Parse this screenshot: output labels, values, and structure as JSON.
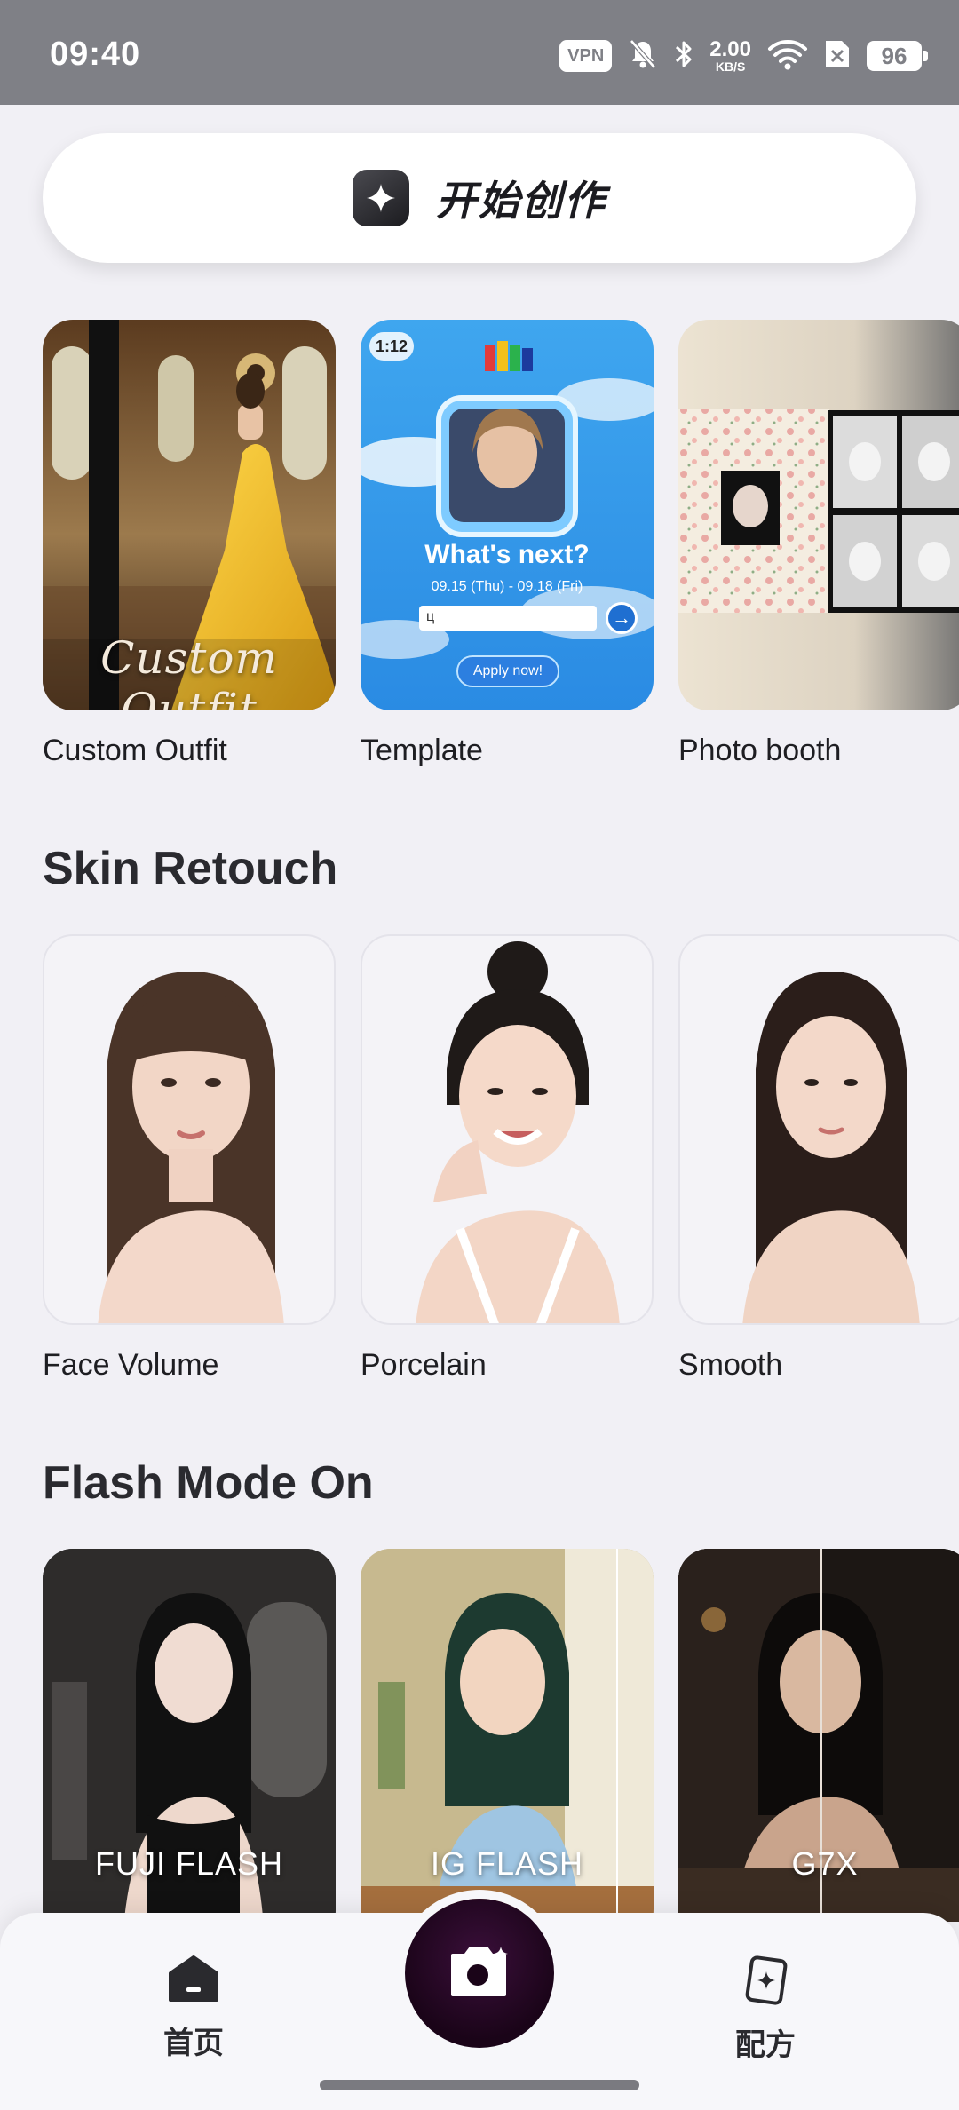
{
  "status_bar": {
    "time": "09:40",
    "vpn": "VPN",
    "speed_value": "2.00",
    "speed_unit": "KB/S",
    "battery": "96"
  },
  "create": {
    "label": "开始创作"
  },
  "features": [
    {
      "caption": "Custom Outfit",
      "overlay": "Custom Outfit"
    },
    {
      "caption": "Template",
      "badge": "1:12",
      "headline": "What's next?",
      "dates": "09.15 (Thu) - 09.18 (Fri)",
      "input_value": "ц",
      "apply": "Apply now!"
    },
    {
      "caption": "Photo booth"
    }
  ],
  "skin_retouch": {
    "title": "Skin Retouch",
    "items": [
      {
        "caption": "Face Volume"
      },
      {
        "caption": "Porcelain"
      },
      {
        "caption": "Smooth"
      }
    ]
  },
  "flash_mode": {
    "title": "Flash Mode On",
    "items": [
      {
        "overlay": "FUJI FLASH"
      },
      {
        "overlay": "IG FLASH"
      },
      {
        "overlay": "G7X"
      }
    ]
  },
  "nav": {
    "home": "首页",
    "recipes": "配方"
  },
  "colors": {
    "background": "#f1f0f5",
    "status_bar": "#7f8086",
    "fab": "#1a0418"
  }
}
